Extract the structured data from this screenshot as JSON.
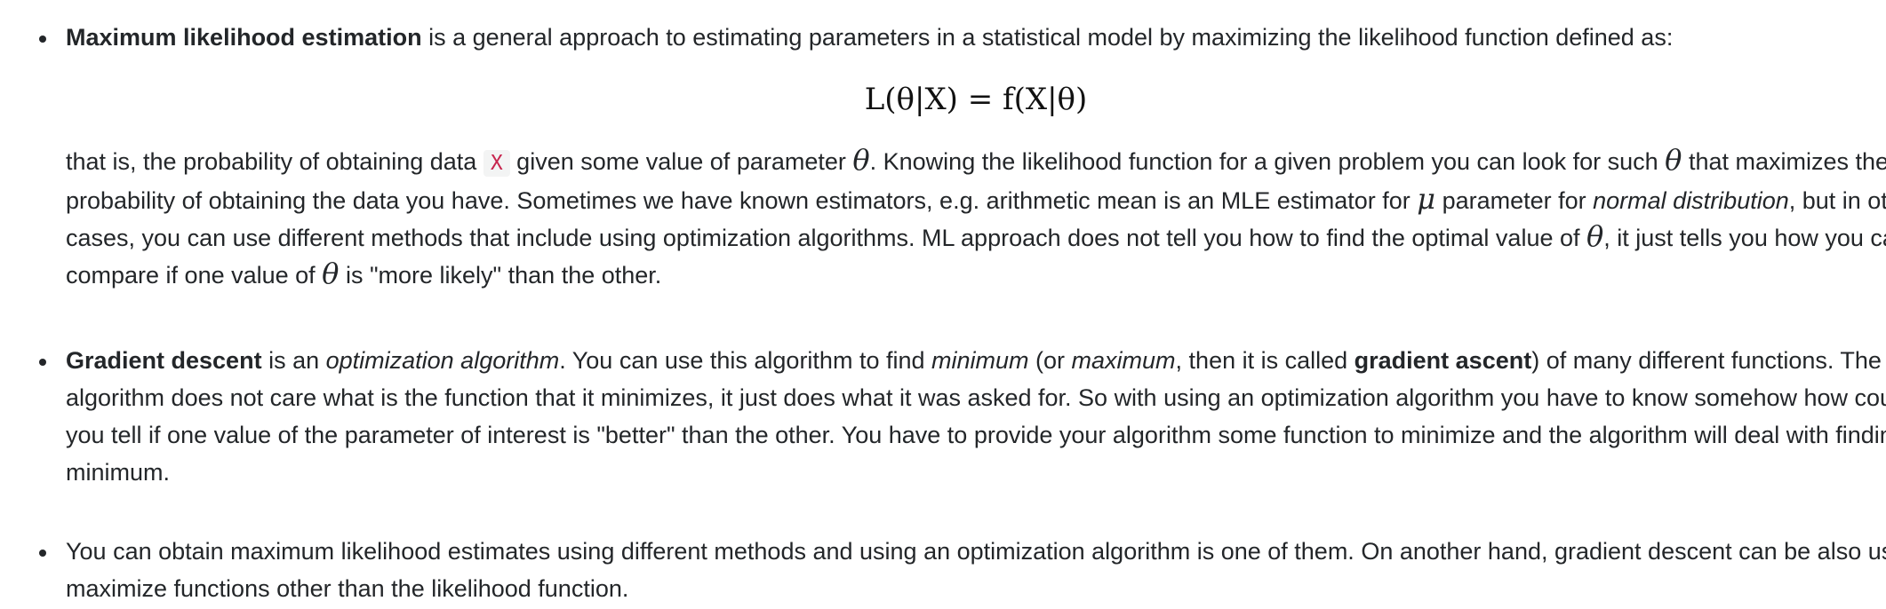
{
  "items": [
    {
      "title": "Maximum likelihood estimation",
      "intro": " is a general approach to estimating parameters in a statistical model by maximizing the likelihood function defined as:",
      "equation": "L(θ|X) = f(X|θ)",
      "t1": "that is, the probability of obtaining data ",
      "code": "X",
      "t2": " given some value of parameter ",
      "theta": "θ",
      "t3": ". Knowing the likelihood function for a given problem you can look for such ",
      "t4": " that maximizes the probability of obtaining the data you have. Sometimes we have known estimators, e.g. arithmetic mean is an MLE estimator for ",
      "mu": "μ",
      "t5": " parameter for ",
      "em1": "normal distribution",
      "t6": ", but in other cases, you can use different methods that include using optimization algorithms. ML approach does not tell you how to find the optimal value of ",
      "t7": ", it just tells you how you can compare if one value of ",
      "t8": " is \"more likely\" than the other."
    },
    {
      "title": "Gradient descent",
      "t1": " is an ",
      "em1": "optimization algorithm",
      "t2": ". You can use this algorithm to find ",
      "em2": "minimum",
      "t3": " (or ",
      "em3": "maximum",
      "t4": ", then it is called ",
      "strong2": "gradient ascent",
      "t5": ") of many different functions. The algorithm does not care what is the function that it minimizes, it just does what it was asked for. So with using an optimization algorithm you have to know somehow how could you tell if one value of the parameter of interest is \"better\" than the other. You have to provide your algorithm some function to minimize and the algorithm will deal with finding its minimum."
    },
    {
      "text": "You can obtain maximum likelihood estimates using different methods and using an optimization algorithm is one of them. On another hand, gradient descent can be also used to maximize functions other than the likelihood function."
    }
  ]
}
